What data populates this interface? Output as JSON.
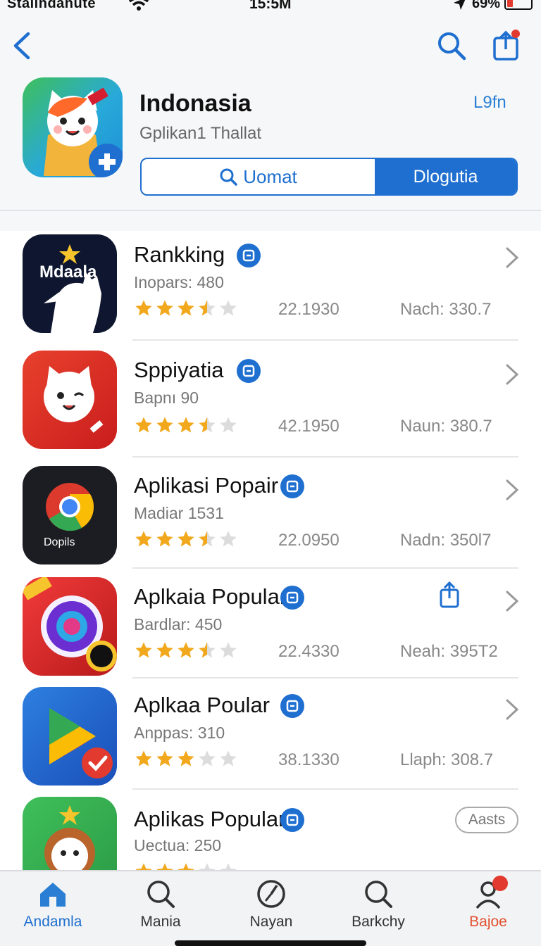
{
  "status_bar": {
    "carrier": "Stallndanute",
    "time": "15:5M",
    "battery": "69%"
  },
  "header": {
    "title": "Indonasia",
    "subtitle": "Gplikan1 Thallat",
    "right_label": "L9fn",
    "segment_left": "Uomat",
    "segment_right": "Dlogutia"
  },
  "apps": [
    {
      "name": "Rankking",
      "meta": "Inopars: 480",
      "num1": "22.1930",
      "num2": "Nach: 330.7",
      "rating": 3.5,
      "icon_text": "Mdaala"
    },
    {
      "name": "Sppiyatia",
      "meta": "Bapnı    90",
      "num1": "42.1950",
      "num2": "Naun: 380.7",
      "rating": 3.5
    },
    {
      "name": "Aplikasi Popair",
      "meta": "Madiar  1531",
      "num1": "22.0950",
      "num2": "Nadn: 350l7",
      "rating": 3.5,
      "icon_text": "Dopils"
    },
    {
      "name": "Aplkaia Popular",
      "meta": "Bardlar: 450",
      "num1": "22.4330",
      "num2": "Neah: 395T2",
      "rating": 3.5
    },
    {
      "name": "Aplkaa Poular",
      "meta": "Anppas: 310",
      "num1": "38.1330",
      "num2": "Llaph: 308.7",
      "rating": 3.0
    },
    {
      "name": "Aplikas Popular",
      "meta": "Uectua: 250",
      "pill": "Aasts",
      "rating": 3.0
    }
  ],
  "tabs": [
    {
      "label": "Andamla",
      "icon": "home-icon"
    },
    {
      "label": "Mania",
      "icon": "search-icon"
    },
    {
      "label": "Nayan",
      "icon": "clock-icon"
    },
    {
      "label": "Barkchy",
      "icon": "search-icon"
    },
    {
      "label": "Bajoe",
      "icon": "person-icon"
    }
  ],
  "colors": {
    "accent": "#1f6fd0",
    "alert": "#e23a2f",
    "star": "#f2a81d"
  }
}
